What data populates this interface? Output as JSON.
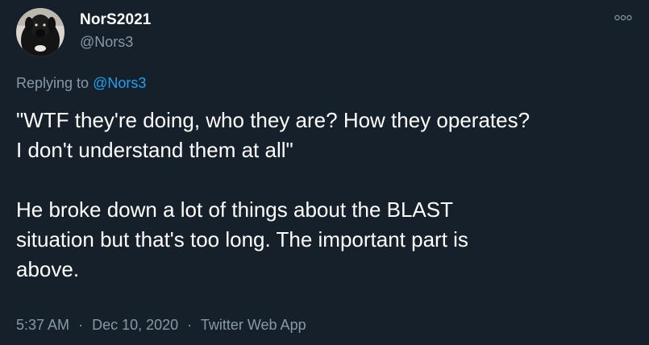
{
  "author": {
    "display_name": "NorS2021",
    "handle": "@Nors3"
  },
  "reply": {
    "prefix": "Replying to",
    "mention": "@Nors3"
  },
  "tweet": {
    "paragraph_1_line_1": "\"WTF they're doing, who they are? How they operates?",
    "paragraph_1_line_2": "I don't understand them at all\"",
    "paragraph_2_line_1": "He broke down a lot of things about the BLAST",
    "paragraph_2_line_2": "situation but that's too long. The important part is",
    "paragraph_2_line_3": "above."
  },
  "meta": {
    "time": "5:37 AM",
    "separator": "·",
    "date": "Dec 10, 2020",
    "app": "Twitter Web App"
  },
  "icons": {
    "more": "more-options-icon",
    "avatar": "dog-avatar"
  },
  "colors": {
    "background": "#15202b",
    "secondary_text": "#8899a6",
    "link": "#1da1f2",
    "primary_text": "#ffffff"
  }
}
